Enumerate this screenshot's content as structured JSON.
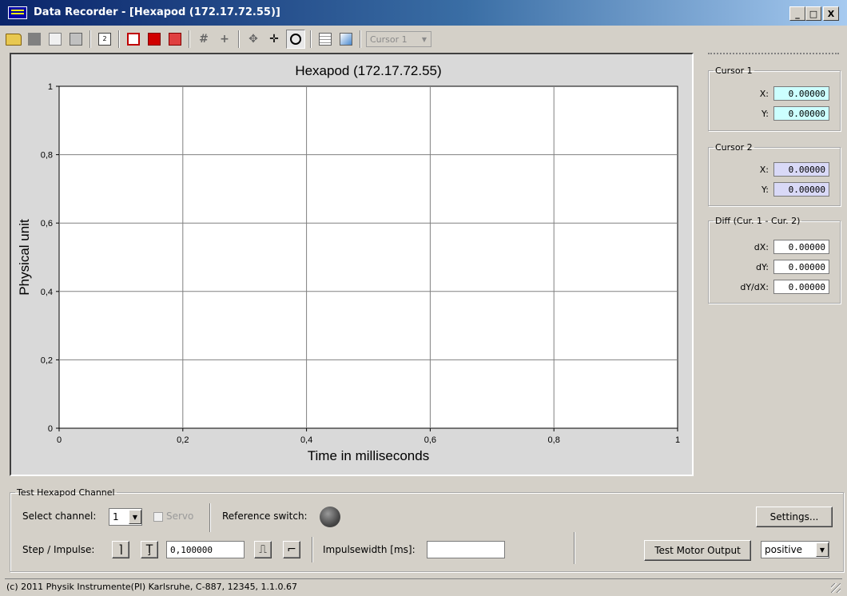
{
  "window": {
    "title": "Data Recorder - [Hexapod (172.17.72.55)]",
    "controls": {
      "minimize": "_",
      "maximize": "□",
      "close": "X"
    }
  },
  "toolbar": {
    "icons": [
      "open-folder-icon",
      "stop-icon",
      "copy-icon",
      "export-icon",
      "scale-icon",
      "chart-line-icon",
      "chart-red-icon",
      "chart-bar-icon",
      "cursor-add-icon",
      "cursor-plus-icon",
      "pan-icon",
      "move-icon",
      "zoom-icon",
      "table-icon",
      "graph-icon"
    ],
    "cursor_select": "Cursor 1"
  },
  "chart_data": {
    "type": "line",
    "title": "Hexapod (172.17.72.55)",
    "xlabel": "Time in milliseconds",
    "ylabel": "Physical unit",
    "xlim": [
      0,
      1
    ],
    "ylim": [
      0,
      1
    ],
    "x_ticks": [
      "0",
      "0,2",
      "0,4",
      "0,6",
      "0,8",
      "1"
    ],
    "y_ticks": [
      "0",
      "0,2",
      "0,4",
      "0,6",
      "0,8",
      "1"
    ],
    "grid": true,
    "series": []
  },
  "cursor1": {
    "legend": "Cursor 1",
    "x_label": "X:",
    "x": "0.00000",
    "y_label": "Y:",
    "y": "0.00000",
    "color": "#ccffff"
  },
  "cursor2": {
    "legend": "Cursor 2",
    "x_label": "X:",
    "x": "0.00000",
    "y_label": "Y:",
    "y": "0.00000",
    "color": "#d9d9f7"
  },
  "diff": {
    "legend": "Diff (Cur. 1 - Cur. 2)",
    "dx_label": "dX:",
    "dx": "0.00000",
    "dy_label": "dY:",
    "dy": "0.00000",
    "dydx_label": "dY/dX:",
    "dydx": "0.00000"
  },
  "test": {
    "legend": "Test Hexapod Channel",
    "select_channel_label": "Select channel:",
    "channel": "1",
    "servo_label": "Servo",
    "reference_label": "Reference switch:",
    "settings_button": "Settings...",
    "step_label": "Step / Impulse:",
    "step_value": "0,100000",
    "impulse_label": "Impulsewidth [ms]:",
    "impulse_value": "",
    "test_motor_button": "Test Motor Output",
    "direction": "positive"
  },
  "status": "(c) 2011 Physik Instrumente(PI) Karlsruhe, C-887, 12345, 1.1.0.67"
}
